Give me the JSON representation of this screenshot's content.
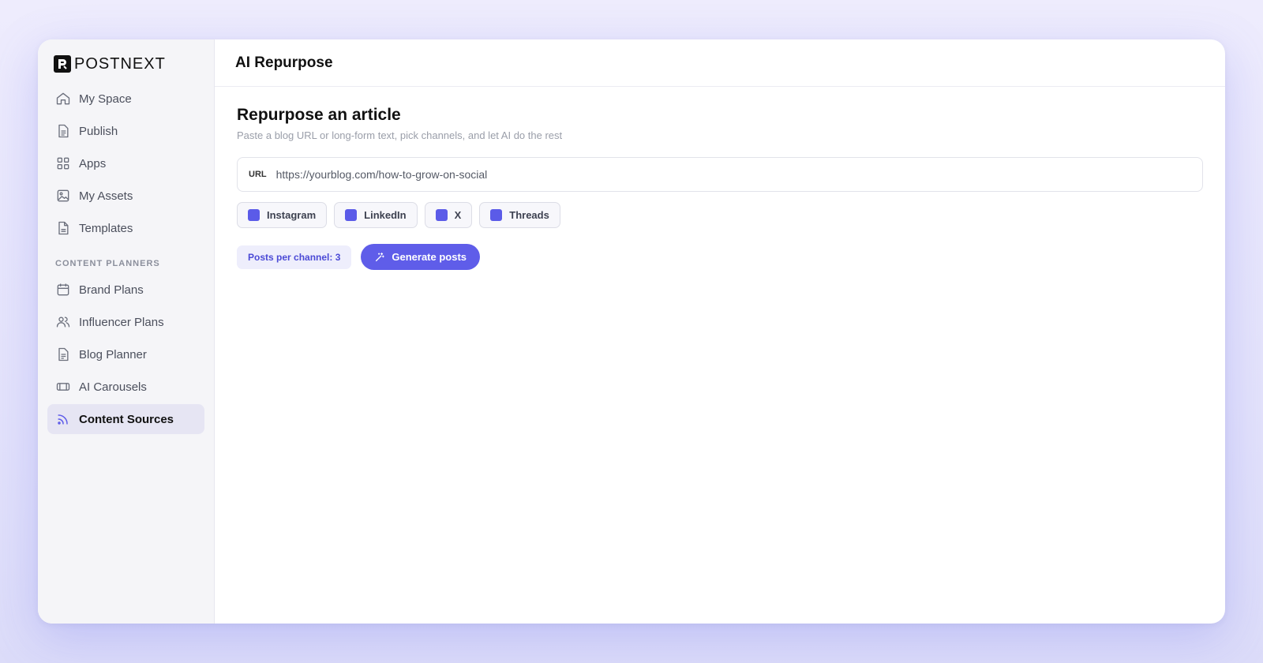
{
  "app": {
    "name": "POSTNEXT",
    "accent": "#5f5de9"
  },
  "sidebar": {
    "items": [
      {
        "label": "My Space",
        "icon": "home-icon"
      },
      {
        "label": "Publish",
        "icon": "document-icon"
      },
      {
        "label": "Apps",
        "icon": "grid-icon"
      },
      {
        "label": "My Assets",
        "icon": "image-icon"
      },
      {
        "label": "Templates",
        "icon": "file-icon"
      }
    ],
    "section_label": "CONTENT PLANNERS",
    "planners": [
      {
        "label": "Brand Plans",
        "icon": "calendar-icon"
      },
      {
        "label": "Influencer Plans",
        "icon": "users-icon"
      },
      {
        "label": "Blog Planner",
        "icon": "file-text-icon"
      },
      {
        "label": "AI Carousels",
        "icon": "carousel-icon"
      },
      {
        "label": "Content Sources",
        "icon": "rss-icon",
        "active": true
      }
    ]
  },
  "header": {
    "title": "AI Repurpose"
  },
  "main": {
    "title": "Repurpose an article",
    "subtitle": "Paste a blog URL or long-form text, pick channels, and let AI do the rest",
    "url_label": "URL",
    "url_value": "https://yourblog.com/how-to-grow-on-social",
    "channels": [
      {
        "label": "Instagram",
        "checked": true
      },
      {
        "label": "LinkedIn",
        "checked": true
      },
      {
        "label": "X",
        "checked": true
      },
      {
        "label": "Threads",
        "checked": true
      }
    ],
    "posts_per_channel": "Posts per channel: 3",
    "generate_label": "Generate posts"
  }
}
